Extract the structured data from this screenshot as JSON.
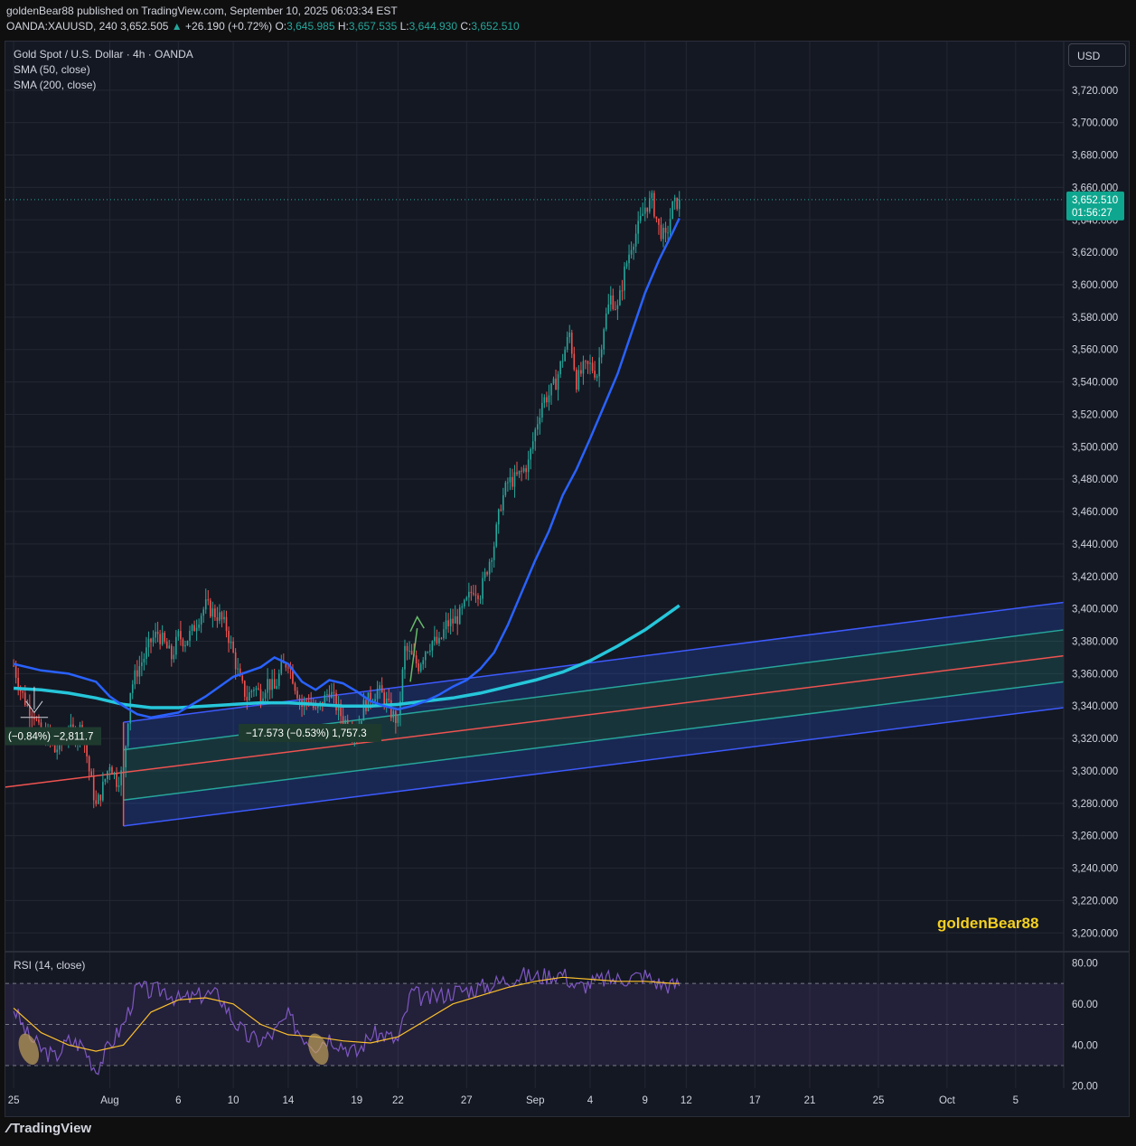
{
  "header": {
    "published": "goldenBear88 published on TradingView.com, September 10, 2025 06:03:34 EST",
    "symbol": "OANDA:XAUUSD, 240",
    "price": "3,652.505",
    "arrow": "▲",
    "change": "+26.190 (+0.72%)",
    "o_label": "O:",
    "o_value": "3,645.985",
    "h_label": "H:",
    "h_value": "3,657.535",
    "l_label": "L:",
    "l_value": "3,644.930",
    "c_label": "C:",
    "c_value": "3,652.510"
  },
  "legend": {
    "title": "Gold Spot / U.S. Dollar · 4h · OANDA",
    "sma50": "SMA (50, close)",
    "sma200": "SMA (200, close)",
    "rsi": "RSI (14, close)"
  },
  "currency_button": "USD",
  "last_price_label": "3,652.510",
  "countdown_label": "01:56:27",
  "watermark": "goldenBear88",
  "footer_logo": "TradingView",
  "annotations": {
    "left_measure": "(−0.84%) −2,811.7",
    "mid_measure": "−17.573 (−0.53%)  1,757.3"
  },
  "colors": {
    "bull": "#26a69a",
    "bear": "#ef5350",
    "sma50": "#2962ff",
    "sma200": "#26c6da",
    "rsi_line": "#7e57c2",
    "rsi_ma": "#fbc02d",
    "channel_outer": "#3d5afe",
    "channel_inner": "#26a69a",
    "channel_mid": "#ef5350"
  },
  "chart_data": {
    "type": "candlestick",
    "y_axis_ticks": [
      3200,
      3220,
      3240,
      3260,
      3280,
      3300,
      3320,
      3340,
      3360,
      3380,
      3400,
      3420,
      3440,
      3460,
      3480,
      3500,
      3520,
      3540,
      3560,
      3580,
      3600,
      3620,
      3640,
      3660,
      3680,
      3700,
      3720
    ],
    "y_axis_labels": [
      "3,200.000",
      "3,220.000",
      "3,240.000",
      "3,260.000",
      "3,280.000",
      "3,300.000",
      "3,320.000",
      "3,340.000",
      "3,360.000",
      "3,380.000",
      "3,400.000",
      "3,420.000",
      "3,440.000",
      "3,460.000",
      "3,480.000",
      "3,500.000",
      "3,520.000",
      "3,540.000",
      "3,560.000",
      "3,580.000",
      "3,600.000",
      "3,620.000",
      "3,640.000",
      "3,660.000",
      "3,680.000",
      "3,700.000",
      "3,720.000"
    ],
    "ylim": [
      3189,
      3750
    ],
    "x_axis_labels": [
      "25",
      "Aug",
      "6",
      "10",
      "14",
      "19",
      "22",
      "27",
      "Sep",
      "4",
      "9",
      "12",
      "17",
      "21",
      "25",
      "Oct",
      "5"
    ],
    "x_axis_days": [
      0,
      7,
      12,
      16,
      20,
      25,
      28,
      33,
      38,
      42,
      46,
      49,
      54,
      58,
      63,
      68,
      73
    ],
    "xlim": [
      -0.6,
      76.5
    ],
    "last_price": 3652.51,
    "close_path": [
      [
        0,
        3365
      ],
      [
        0.5,
        3350
      ],
      [
        1,
        3340
      ],
      [
        1.5,
        3335
      ],
      [
        2,
        3320
      ],
      [
        2.5,
        3322
      ],
      [
        3,
        3312
      ],
      [
        3.5,
        3318
      ],
      [
        4,
        3325
      ],
      [
        4.5,
        3322
      ],
      [
        5,
        3328
      ],
      [
        5.5,
        3300
      ],
      [
        6,
        3278
      ],
      [
        6.5,
        3290
      ],
      [
        7,
        3305
      ],
      [
        7.5,
        3294
      ],
      [
        8,
        3300
      ],
      [
        8.5,
        3350
      ],
      [
        9,
        3362
      ],
      [
        9.5,
        3370
      ],
      [
        10,
        3380
      ],
      [
        10.5,
        3385
      ],
      [
        11,
        3378
      ],
      [
        11.5,
        3370
      ],
      [
        12,
        3383
      ],
      [
        12.5,
        3380
      ],
      [
        13,
        3386
      ],
      [
        13.5,
        3395
      ],
      [
        14,
        3402
      ],
      [
        14.5,
        3398
      ],
      [
        15,
        3395
      ],
      [
        15.5,
        3388
      ],
      [
        16,
        3372
      ],
      [
        16.5,
        3355
      ],
      [
        17,
        3345
      ],
      [
        17.5,
        3352
      ],
      [
        18,
        3347
      ],
      [
        18.5,
        3355
      ],
      [
        19,
        3350
      ],
      [
        19.5,
        3363
      ],
      [
        20,
        3368
      ],
      [
        20.5,
        3353
      ],
      [
        21,
        3340
      ],
      [
        21.5,
        3345
      ],
      [
        22,
        3336
      ],
      [
        22.5,
        3342
      ],
      [
        23,
        3350
      ],
      [
        23.5,
        3340
      ],
      [
        24,
        3332
      ],
      [
        24.5,
        3328
      ],
      [
        25,
        3324
      ],
      [
        25.5,
        3340
      ],
      [
        26,
        3345
      ],
      [
        26.5,
        3350
      ],
      [
        27,
        3345
      ],
      [
        27.5,
        3336
      ],
      [
        28,
        3330
      ],
      [
        28.5,
        3375
      ],
      [
        29,
        3370
      ],
      [
        29.5,
        3365
      ],
      [
        30,
        3375
      ],
      [
        30.5,
        3380
      ],
      [
        31,
        3378
      ],
      [
        31.5,
        3390
      ],
      [
        32,
        3392
      ],
      [
        32.5,
        3396
      ],
      [
        33,
        3404
      ],
      [
        33.5,
        3413
      ],
      [
        34,
        3410
      ],
      [
        34.5,
        3425
      ],
      [
        35,
        3440
      ],
      [
        35.5,
        3465
      ],
      [
        36,
        3478
      ],
      [
        36.5,
        3480
      ],
      [
        37,
        3484
      ],
      [
        37.5,
        3490
      ],
      [
        38,
        3510
      ],
      [
        38.5,
        3528
      ],
      [
        39,
        3532
      ],
      [
        39.5,
        3540
      ],
      [
        40,
        3555
      ],
      [
        40.5,
        3570
      ],
      [
        41,
        3540
      ],
      [
        41.5,
        3548
      ],
      [
        42,
        3550
      ],
      [
        42.5,
        3545
      ],
      [
        43,
        3575
      ],
      [
        43.5,
        3592
      ],
      [
        44,
        3585
      ],
      [
        44.5,
        3608
      ],
      [
        45,
        3625
      ],
      [
        45.5,
        3635
      ],
      [
        46,
        3648
      ],
      [
        46.5,
        3652
      ],
      [
        47,
        3635
      ],
      [
        47.5,
        3628
      ],
      [
        48,
        3648
      ],
      [
        48.5,
        3652
      ]
    ],
    "sma50": [
      [
        0,
        3366
      ],
      [
        2,
        3362
      ],
      [
        4,
        3360
      ],
      [
        6,
        3355
      ],
      [
        7,
        3346
      ],
      [
        8,
        3340
      ],
      [
        9,
        3335
      ],
      [
        10,
        3333
      ],
      [
        12,
        3336
      ],
      [
        14,
        3346
      ],
      [
        16,
        3358
      ],
      [
        18,
        3364
      ],
      [
        19,
        3370
      ],
      [
        20,
        3366
      ],
      [
        21,
        3355
      ],
      [
        22,
        3350
      ],
      [
        23,
        3356
      ],
      [
        24,
        3354
      ],
      [
        25,
        3349
      ],
      [
        26,
        3343
      ],
      [
        27,
        3340
      ],
      [
        28,
        3338
      ],
      [
        29,
        3340
      ],
      [
        30,
        3343
      ],
      [
        31,
        3347
      ],
      [
        32,
        3352
      ],
      [
        33,
        3356
      ],
      [
        34,
        3363
      ],
      [
        35,
        3373
      ],
      [
        36,
        3390
      ],
      [
        37,
        3410
      ],
      [
        38,
        3430
      ],
      [
        39,
        3448
      ],
      [
        40,
        3470
      ],
      [
        41,
        3486
      ],
      [
        42,
        3505
      ],
      [
        43,
        3525
      ],
      [
        44,
        3545
      ],
      [
        45,
        3570
      ],
      [
        46,
        3595
      ],
      [
        47,
        3615
      ],
      [
        48,
        3632
      ],
      [
        48.5,
        3641
      ]
    ],
    "sma200": [
      [
        0,
        3351
      ],
      [
        2,
        3350
      ],
      [
        4,
        3348
      ],
      [
        6,
        3345
      ],
      [
        8,
        3341
      ],
      [
        10,
        3339
      ],
      [
        12,
        3339
      ],
      [
        14,
        3340
      ],
      [
        16,
        3341
      ],
      [
        18,
        3342
      ],
      [
        20,
        3342
      ],
      [
        22,
        3341
      ],
      [
        24,
        3340
      ],
      [
        26,
        3340
      ],
      [
        28,
        3341
      ],
      [
        30,
        3343
      ],
      [
        32,
        3345
      ],
      [
        34,
        3348
      ],
      [
        36,
        3352
      ],
      [
        38,
        3356
      ],
      [
        40,
        3361
      ],
      [
        42,
        3368
      ],
      [
        44,
        3377
      ],
      [
        46,
        3387
      ],
      [
        48,
        3399
      ],
      [
        48.5,
        3402
      ]
    ],
    "regression_channel": {
      "start_x": 8,
      "end_x": 76.5,
      "upper_start": 3330,
      "upper_end": 3404,
      "upper_dev_start": 3313,
      "upper_dev_end": 3387,
      "mid_start": 3298,
      "mid_end": 3371,
      "lower_dev_start": 3282,
      "lower_dev_end": 3355,
      "lower_start": 3266,
      "lower_end": 3339
    },
    "rsi": {
      "levels": [
        70,
        50,
        30
      ],
      "ticks": [
        80,
        60,
        40,
        20
      ],
      "tick_labels": [
        "80.00",
        "60.00",
        "40.00",
        "20.00"
      ],
      "ylim": [
        19,
        85
      ],
      "values": [
        [
          0,
          58
        ],
        [
          1,
          45
        ],
        [
          2,
          38
        ],
        [
          3,
          34
        ],
        [
          4,
          42
        ],
        [
          5,
          40
        ],
        [
          6,
          28
        ],
        [
          7,
          40
        ],
        [
          8,
          50
        ],
        [
          9,
          68
        ],
        [
          10,
          66
        ],
        [
          11,
          67
        ],
        [
          12,
          62
        ],
        [
          13,
          63
        ],
        [
          14,
          65
        ],
        [
          15,
          64
        ],
        [
          16,
          52
        ],
        [
          17,
          44
        ],
        [
          18,
          42
        ],
        [
          19,
          46
        ],
        [
          20,
          54
        ],
        [
          21,
          45
        ],
        [
          22,
          40
        ],
        [
          23,
          44
        ],
        [
          24,
          40
        ],
        [
          25,
          36
        ],
        [
          26,
          45
        ],
        [
          27,
          45
        ],
        [
          28,
          42
        ],
        [
          29,
          66
        ],
        [
          30,
          62
        ],
        [
          31,
          64
        ],
        [
          32,
          66
        ],
        [
          33,
          67
        ],
        [
          34,
          68
        ],
        [
          35,
          70
        ],
        [
          36,
          72
        ],
        [
          37,
          74
        ],
        [
          38,
          73
        ],
        [
          39,
          74
        ],
        [
          40,
          75
        ],
        [
          41,
          68
        ],
        [
          42,
          70
        ],
        [
          43,
          72
        ],
        [
          44,
          72
        ],
        [
          45,
          73
        ],
        [
          46,
          74
        ],
        [
          47,
          70
        ],
        [
          48,
          69
        ],
        [
          48.5,
          70
        ]
      ],
      "ma": [
        [
          0,
          58
        ],
        [
          2,
          46
        ],
        [
          4,
          40
        ],
        [
          6,
          37
        ],
        [
          8,
          40
        ],
        [
          10,
          56
        ],
        [
          12,
          62
        ],
        [
          14,
          63
        ],
        [
          16,
          60
        ],
        [
          18,
          50
        ],
        [
          20,
          45
        ],
        [
          22,
          44
        ],
        [
          24,
          42
        ],
        [
          26,
          41
        ],
        [
          28,
          44
        ],
        [
          30,
          52
        ],
        [
          32,
          60
        ],
        [
          34,
          64
        ],
        [
          36,
          68
        ],
        [
          38,
          71
        ],
        [
          40,
          73
        ],
        [
          42,
          72
        ],
        [
          44,
          71
        ],
        [
          46,
          71
        ],
        [
          48,
          70
        ],
        [
          48.5,
          70
        ]
      ]
    }
  }
}
